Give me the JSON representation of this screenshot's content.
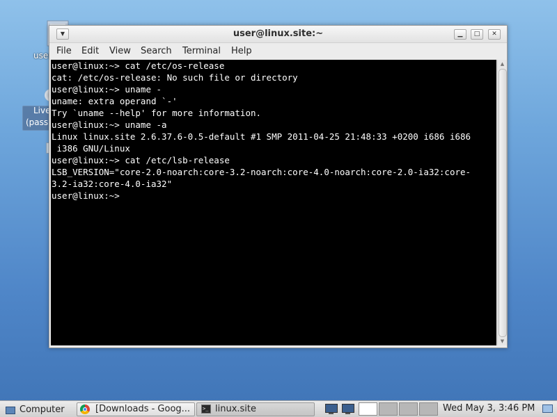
{
  "desktop": {
    "icons": [
      {
        "label": "user",
        "icon": "folder-icon"
      },
      {
        "label_line1": "Live",
        "label_line2": "(pass",
        "icon": "cd-icon"
      }
    ]
  },
  "window": {
    "title": "user@linux.site:~",
    "menu": [
      "File",
      "Edit",
      "View",
      "Search",
      "Terminal",
      "Help"
    ],
    "controls": {
      "minimize": "▁",
      "maximize": "□",
      "close": "✕",
      "menu": "▼"
    }
  },
  "terminal": {
    "lines": [
      "user@linux:~> cat /etc/os-release",
      "cat: /etc/os-release: No such file or directory",
      "user@linux:~> uname -",
      "uname: extra operand `-'",
      "Try `uname --help' for more information.",
      "user@linux:~> uname -a",
      "Linux linux.site 2.6.37.6-0.5-default #1 SMP 2011-04-25 21:48:33 +0200 i686 i686",
      " i386 GNU/Linux",
      "user@linux:~> cat /etc/lsb-release",
      "LSB_VERSION=\"core-2.0-noarch:core-3.2-noarch:core-4.0-noarch:core-2.0-ia32:core-",
      "3.2-ia32:core-4.0-ia32\"",
      "user@linux:~> "
    ]
  },
  "taskbar": {
    "menu_button": "Computer",
    "tasks": [
      {
        "label": "[Downloads - Goog...",
        "icon": "chrome-icon"
      },
      {
        "label": "linux.site",
        "icon": "terminal-icon"
      }
    ],
    "workspaces": 4,
    "clock": "Wed May  3,  3:46 PM"
  }
}
